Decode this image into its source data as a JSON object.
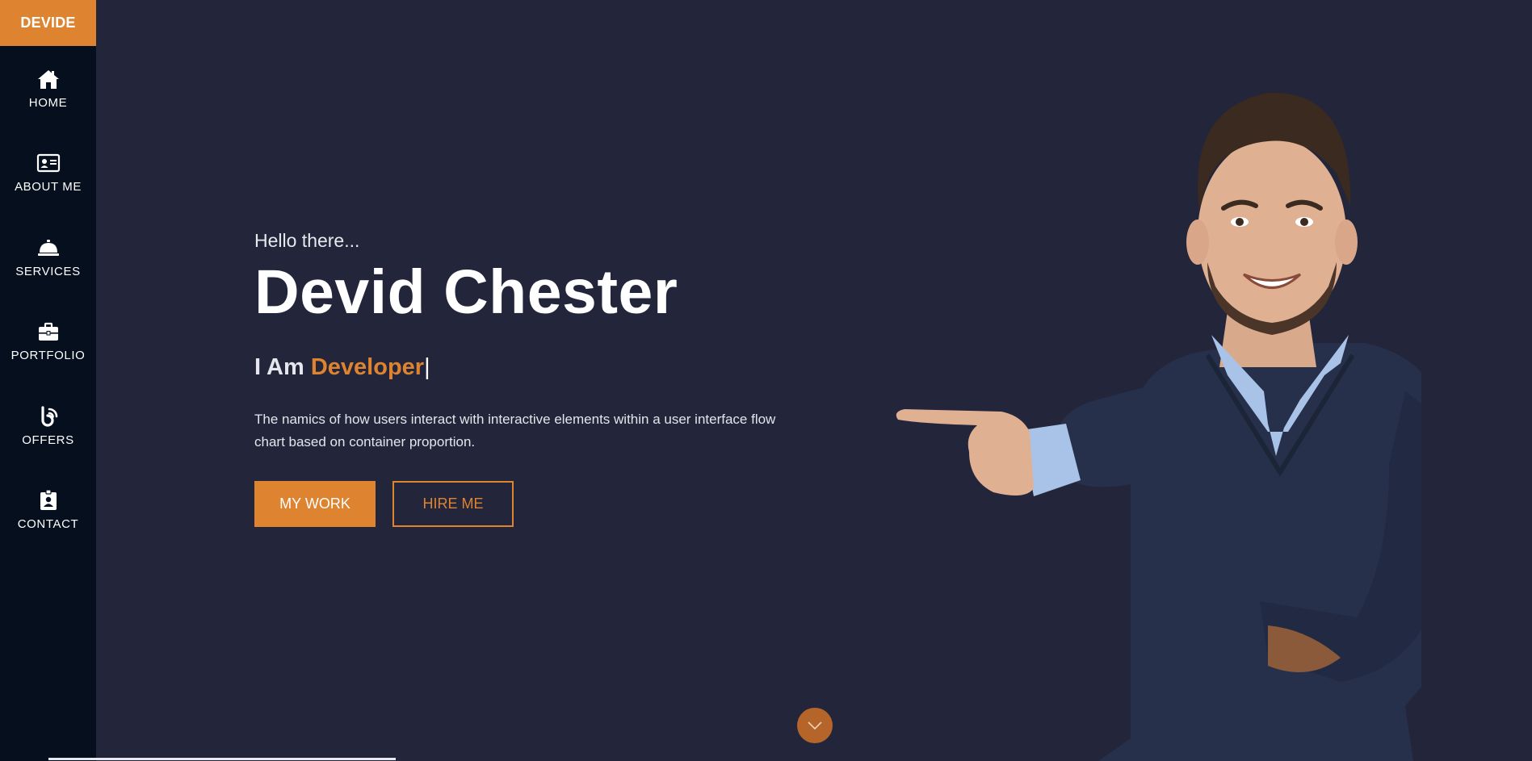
{
  "brand": "DEVIDE",
  "nav": [
    {
      "label": "HOME",
      "icon": "home-icon"
    },
    {
      "label": "ABOUT ME",
      "icon": "id-card-icon"
    },
    {
      "label": "SERVICES",
      "icon": "service-bell-icon"
    },
    {
      "label": "PORTFOLIO",
      "icon": "briefcase-icon"
    },
    {
      "label": "OFFERS",
      "icon": "blog-icon"
    },
    {
      "label": "CONTACT",
      "icon": "id-badge-icon"
    }
  ],
  "hero": {
    "greeting": "Hello there...",
    "name": "Devid Chester",
    "role_prefix": "I Am",
    "role_highlight": "Developer",
    "cursor": "|",
    "description": "The namics of how users interact with interactive elements within a user interface flow chart based on container proportion.",
    "primary_button": "MY WORK",
    "secondary_button": "HIRE ME"
  },
  "scroll_icon": "chevron-down-icon",
  "colors": {
    "accent": "#de8430",
    "background": "#23253b",
    "sidebar": "#050f1e"
  }
}
